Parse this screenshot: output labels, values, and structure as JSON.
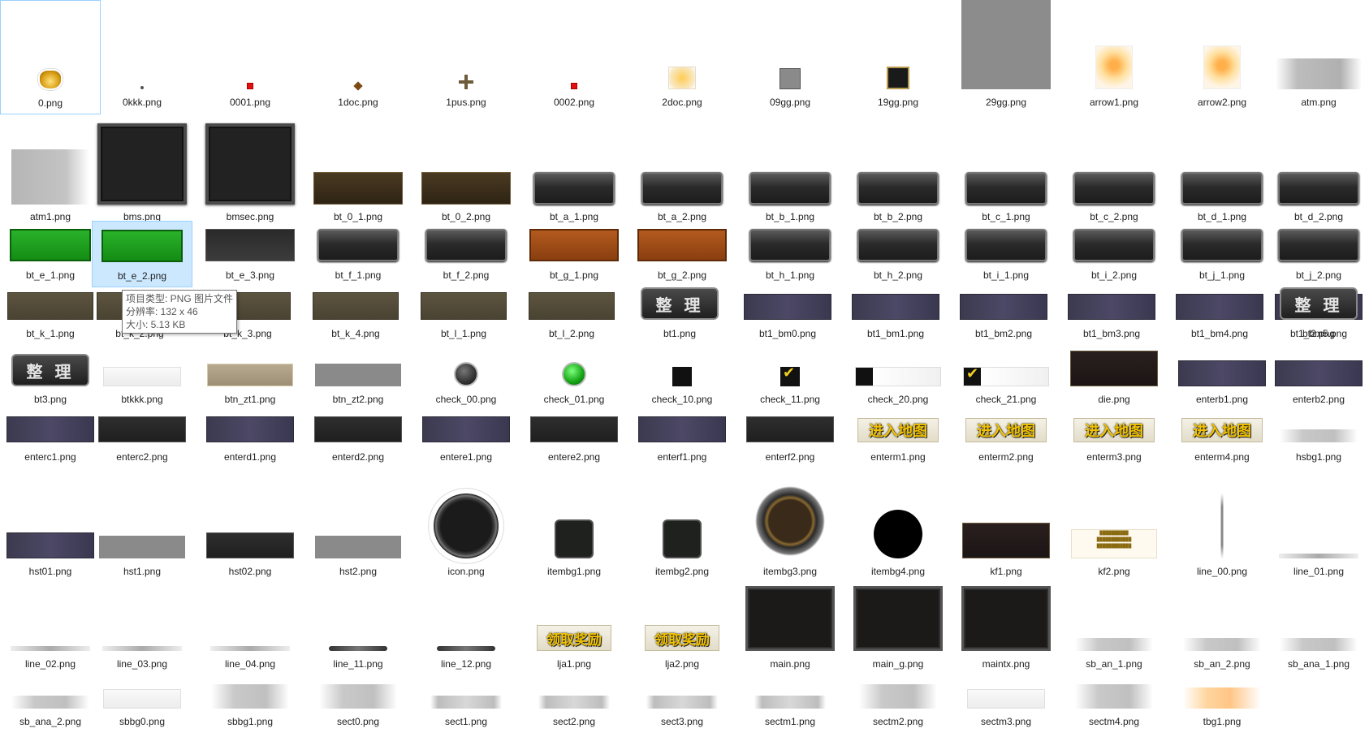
{
  "files": [
    {
      "name": "0.png",
      "icon": "gold-ingot-icon"
    },
    {
      "name": "0kkk.png",
      "icon": "tiny-dot-icon"
    },
    {
      "name": "0001.png",
      "icon": "red-dot-icon"
    },
    {
      "name": "1doc.png",
      "icon": "diamond-dot-icon"
    },
    {
      "name": "1pus.png",
      "icon": "plus-icon"
    },
    {
      "name": "0002.png",
      "icon": "red-dot-icon"
    },
    {
      "name": "2doc.png",
      "icon": "arrow-right-icon"
    },
    {
      "name": "09gg.png",
      "icon": "gray-square"
    },
    {
      "name": "19gg.png",
      "icon": "dark-square"
    },
    {
      "name": "29gg.png",
      "icon": "large-gray-square"
    },
    {
      "name": "arrow1.png",
      "icon": "glow-arrow-down-icon"
    },
    {
      "name": "arrow2.png",
      "icon": "glow-arrow-down-icon"
    },
    {
      "name": "atm.png",
      "icon": "gray-gradient-bar"
    },
    {
      "name": "atm1.png",
      "icon": "gray-gradient-panel"
    },
    {
      "name": "bms.png",
      "icon": "dark-frame-panel"
    },
    {
      "name": "bmsec.png",
      "icon": "dark-frame-panel"
    },
    {
      "name": "bt_0_1.png",
      "icon": "brown-button"
    },
    {
      "name": "bt_0_2.png",
      "icon": "brown-button"
    },
    {
      "name": "bt_a_1.png",
      "icon": "stone-button"
    },
    {
      "name": "bt_a_2.png",
      "icon": "stone-button"
    },
    {
      "name": "bt_b_1.png",
      "icon": "stone-button"
    },
    {
      "name": "bt_b_2.png",
      "icon": "stone-button"
    },
    {
      "name": "bt_c_1.png",
      "icon": "stone-button"
    },
    {
      "name": "bt_c_2.png",
      "icon": "stone-button"
    },
    {
      "name": "bt_d_1.png",
      "icon": "stone-button"
    },
    {
      "name": "bt_d_2.png",
      "icon": "stone-button"
    },
    {
      "name": "bt_e_1.png",
      "icon": "green-button"
    },
    {
      "name": "bt_e_2.png",
      "icon": "green-button"
    },
    {
      "name": "bt_e_3.png",
      "icon": "dark-button"
    },
    {
      "name": "bt_f_1.png",
      "icon": "stone-button"
    },
    {
      "name": "bt_f_2.png",
      "icon": "stone-button"
    },
    {
      "name": "bt_g_1.png",
      "icon": "copper-button"
    },
    {
      "name": "bt_g_2.png",
      "icon": "copper-button"
    },
    {
      "name": "bt_h_1.png",
      "icon": "stone-button"
    },
    {
      "name": "bt_h_2.png",
      "icon": "stone-button"
    },
    {
      "name": "bt_i_1.png",
      "icon": "stone-button"
    },
    {
      "name": "bt_i_2.png",
      "icon": "stone-button"
    },
    {
      "name": "bt_j_1.png",
      "icon": "stone-button"
    },
    {
      "name": "bt_j_2.png",
      "icon": "stone-button"
    },
    {
      "name": "bt_k_1.png",
      "icon": "brown-bar"
    },
    {
      "name": "bt_k_2.png",
      "icon": "brown-bar"
    },
    {
      "name": "bt_k_3.png",
      "icon": "brown-bar"
    },
    {
      "name": "bt_k_4.png",
      "icon": "brown-bar"
    },
    {
      "name": "bt_l_1.png",
      "icon": "brown-bar"
    },
    {
      "name": "bt_l_2.png",
      "icon": "brown-bar"
    },
    {
      "name": "bt1.png",
      "icon": "sort-button",
      "text": "整 理"
    },
    {
      "name": "bt1_bm0.png",
      "icon": "purple-bar"
    },
    {
      "name": "bt1_bm1.png",
      "icon": "purple-bar"
    },
    {
      "name": "bt1_bm2.png",
      "icon": "purple-bar"
    },
    {
      "name": "bt1_bm3.png",
      "icon": "purple-bar"
    },
    {
      "name": "bt1_bm4.png",
      "icon": "purple-bar"
    },
    {
      "name": "bt1_bm5.png",
      "icon": "purple-bar"
    },
    {
      "name": "bt2.png",
      "icon": "sort-button",
      "text": "整 理"
    },
    {
      "name": "bt3.png",
      "icon": "sort-button",
      "text": "整 理"
    },
    {
      "name": "btkkk.png",
      "icon": "white-bar"
    },
    {
      "name": "btn_zt1.png",
      "icon": "tan-bar"
    },
    {
      "name": "btn_zt2.png",
      "icon": "gray-bar"
    },
    {
      "name": "check_00.png",
      "icon": "gray-orb-icon"
    },
    {
      "name": "check_01.png",
      "icon": "green-orb-icon"
    },
    {
      "name": "check_10.png",
      "icon": "black-checkbox-icon"
    },
    {
      "name": "check_11.png",
      "icon": "checked-box-icon"
    },
    {
      "name": "check_20.png",
      "icon": "checkbox-bar"
    },
    {
      "name": "check_21.png",
      "icon": "checked-box-bar"
    },
    {
      "name": "die.png",
      "icon": "dark-panel"
    },
    {
      "name": "enterb1.png",
      "icon": "purple-bar"
    },
    {
      "name": "enterb2.png",
      "icon": "purple-bar"
    },
    {
      "name": "enterc1.png",
      "icon": "purple-bar"
    },
    {
      "name": "enterc2.png",
      "icon": "dark-bar"
    },
    {
      "name": "enterd1.png",
      "icon": "purple-bar"
    },
    {
      "name": "enterd2.png",
      "icon": "dark-bar"
    },
    {
      "name": "entere1.png",
      "icon": "purple-bar"
    },
    {
      "name": "entere2.png",
      "icon": "dark-bar"
    },
    {
      "name": "enterf1.png",
      "icon": "purple-bar"
    },
    {
      "name": "enterf2.png",
      "icon": "dark-bar"
    },
    {
      "name": "enterm1.png",
      "icon": "enter-map-button",
      "text": "进入地图"
    },
    {
      "name": "enterm2.png",
      "icon": "enter-map-button",
      "text": "进入地图"
    },
    {
      "name": "enterm3.png",
      "icon": "enter-map-button",
      "text": "进入地图"
    },
    {
      "name": "enterm4.png",
      "icon": "enter-map-button",
      "text": "进入地图"
    },
    {
      "name": "hsbg1.png",
      "icon": "fade-bar"
    },
    {
      "name": "hst01.png",
      "icon": "purple-bar"
    },
    {
      "name": "hst1.png",
      "icon": "gray-bar"
    },
    {
      "name": "hst02.png",
      "icon": "dark-bar"
    },
    {
      "name": "hst2.png",
      "icon": "gray-bar"
    },
    {
      "name": "icon.png",
      "icon": "round-frame-icon"
    },
    {
      "name": "itembg1.png",
      "icon": "item-slot-icon"
    },
    {
      "name": "itembg2.png",
      "icon": "item-slot-icon"
    },
    {
      "name": "itembg3.png",
      "icon": "ornate-slot-icon"
    },
    {
      "name": "itembg4.png",
      "icon": "black-circle-icon"
    },
    {
      "name": "kf1.png",
      "icon": "dark-panel"
    },
    {
      "name": "kf2.png",
      "icon": "notice-card"
    },
    {
      "name": "line_00.png",
      "icon": "vertical-line"
    },
    {
      "name": "line_01.png",
      "icon": "thin-line"
    },
    {
      "name": "line_02.png",
      "icon": "thin-line"
    },
    {
      "name": "line_03.png",
      "icon": "thin-line"
    },
    {
      "name": "line_04.png",
      "icon": "thin-line"
    },
    {
      "name": "line_11.png",
      "icon": "ornate-line"
    },
    {
      "name": "line_12.png",
      "icon": "ornate-line"
    },
    {
      "name": "lja1.png",
      "icon": "claim-reward-button",
      "text": "领取奖励"
    },
    {
      "name": "lja2.png",
      "icon": "claim-reward-button",
      "text": "领取奖励"
    },
    {
      "name": "main.png",
      "icon": "main-frame-panel"
    },
    {
      "name": "main_g.png",
      "icon": "main-frame-panel"
    },
    {
      "name": "maintx.png",
      "icon": "main-frame-panel"
    },
    {
      "name": "sb_an_1.png",
      "icon": "fade-bar"
    },
    {
      "name": "sb_an_2.png",
      "icon": "fade-bar"
    },
    {
      "name": "sb_ana_1.png",
      "icon": "fade-bar"
    },
    {
      "name": "sb_ana_2.png",
      "icon": "fade-bar"
    },
    {
      "name": "sbbg0.png",
      "icon": "white-bar"
    },
    {
      "name": "sbbg1.png",
      "icon": "light-bar"
    },
    {
      "name": "sect0.png",
      "icon": "light-bar"
    },
    {
      "name": "sect1.png",
      "icon": "divider-bar"
    },
    {
      "name": "sect2.png",
      "icon": "divider-bar"
    },
    {
      "name": "sect3.png",
      "icon": "divider-bar"
    },
    {
      "name": "sectm1.png",
      "icon": "divider-bar"
    },
    {
      "name": "sectm2.png",
      "icon": "light-bar"
    },
    {
      "name": "sectm3.png",
      "icon": "white-bar"
    },
    {
      "name": "sectm4.png",
      "icon": "light-bar"
    },
    {
      "name": "tbg1.png",
      "icon": "orange-fade-bar"
    }
  ],
  "tooltip": {
    "type_line": "项目类型: PNG 图片文件",
    "dimensions_line": "分辨率: 132 x 46",
    "size_line": "大小: 5.13 KB"
  },
  "kf2_text": [
    "██████████",
    "████████████",
    "████████████"
  ]
}
